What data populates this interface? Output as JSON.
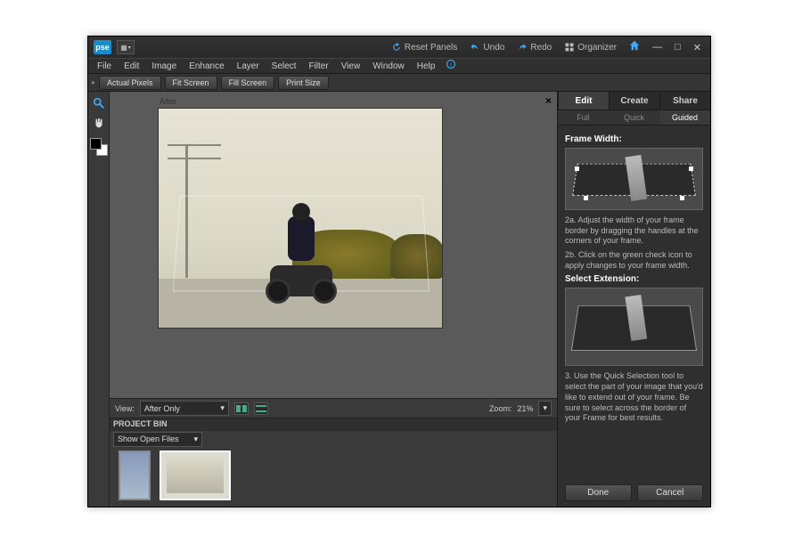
{
  "titlebar": {
    "logo_text": "pse",
    "reset_panels": "Reset Panels",
    "undo": "Undo",
    "redo": "Redo",
    "organizer": "Organizer"
  },
  "menubar": [
    "File",
    "Edit",
    "Image",
    "Enhance",
    "Layer",
    "Select",
    "Filter",
    "View",
    "Window",
    "Help"
  ],
  "optbar": {
    "actual_pixels": "Actual Pixels",
    "fit_screen": "Fit Screen",
    "fill_screen": "Fill Screen",
    "print_size": "Print Size"
  },
  "canvas": {
    "after_label": "After"
  },
  "viewbar": {
    "view_label": "View:",
    "view_mode": "After Only",
    "zoom_label": "Zoom:",
    "zoom_value": "21%"
  },
  "projectbin": {
    "title": "PROJECT BIN",
    "filter": "Show Open Files"
  },
  "right": {
    "modes": {
      "edit": "Edit",
      "create": "Create",
      "share": "Share"
    },
    "subs": {
      "full": "Full",
      "quick": "Quick",
      "guided": "Guided"
    },
    "frame_width_title": "Frame Width:",
    "step2a": "2a. Adjust the width of your frame border by dragging the handles at the corners of your frame.",
    "step2b": "2b. Click on the green check icon to apply changes to your frame width.",
    "select_ext_title": "Select Extension:",
    "step3": "3. Use the Quick Selection tool to select the part of your image that you'd like to extend out of your frame. Be sure to select across the border of your Frame for best results.",
    "done": "Done",
    "cancel": "Cancel"
  }
}
